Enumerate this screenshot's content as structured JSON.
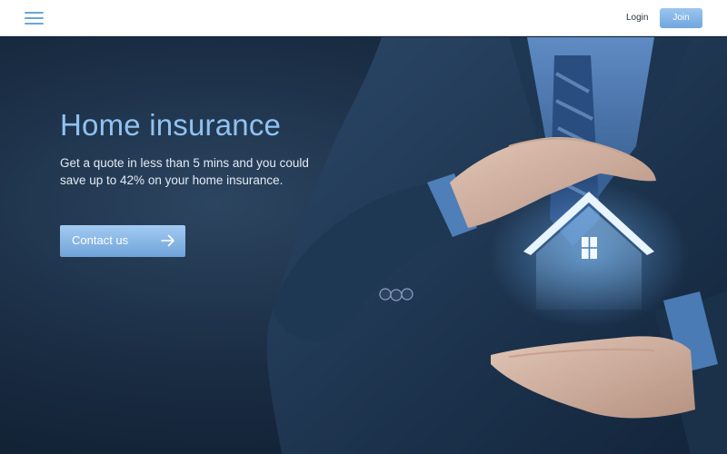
{
  "header": {
    "menu_icon": "hamburger-menu-icon",
    "login_label": "Login",
    "join_label": "Join"
  },
  "hero": {
    "title": "Home insurance",
    "subtitle": "Get a quote in less than 5 mins and you could save up to 42% on your home insurance.",
    "cta_label": "Contact us",
    "cta_icon": "arrow-right-icon",
    "image_icon": "house-icon"
  },
  "colors": {
    "accent": "#7bb2e6",
    "title": "#8fc2f2",
    "background": "#1a2d44",
    "header_bg": "#ffffff"
  }
}
